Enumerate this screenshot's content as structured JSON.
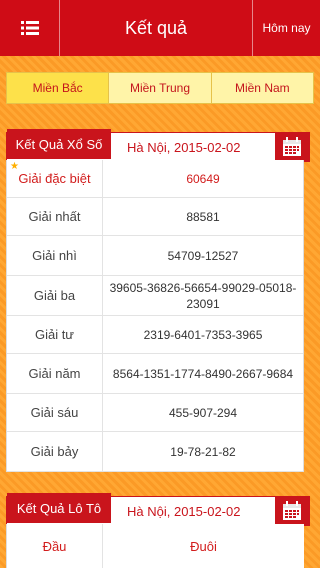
{
  "nav": {
    "title": "Kết quả",
    "today_label": "Hôm nay",
    "menu_icon": "menu-icon"
  },
  "regions": [
    "Miền Bắc",
    "Miền Trung",
    "Miền Nam"
  ],
  "results": {
    "section_label": "Kết Quả Xổ Số",
    "date_label": "Hà Nội, 2015-02-02",
    "calendar_icon": "calendar-icon",
    "rows": [
      {
        "label": "Giải đặc biệt",
        "value": "60649"
      },
      {
        "label": "Giải nhất",
        "value": "88581"
      },
      {
        "label": "Giải nhì",
        "value": "54709-12527"
      },
      {
        "label": "Giải ba",
        "value": "39605-36826-56654-99029-05018-23091"
      },
      {
        "label": "Giải tư",
        "value": "2319-6401-7353-3965"
      },
      {
        "label": "Giải năm",
        "value": "8564-1351-1774-8490-2667-9684"
      },
      {
        "label": "Giải sáu",
        "value": "455-907-294"
      },
      {
        "label": "Giải bảy",
        "value": "19-78-21-82"
      }
    ]
  },
  "loto": {
    "section_label": "Kết Quả Lô Tô",
    "date_label": "Hà Nội, 2015-02-02",
    "col_head": "Đầu",
    "col_tail": "Đuôi"
  },
  "colors": {
    "brand_red": "#cf0c16",
    "tab_bg": "#fff4a8",
    "tab_active": "#fde14a",
    "background_orange": "#ffa733"
  }
}
